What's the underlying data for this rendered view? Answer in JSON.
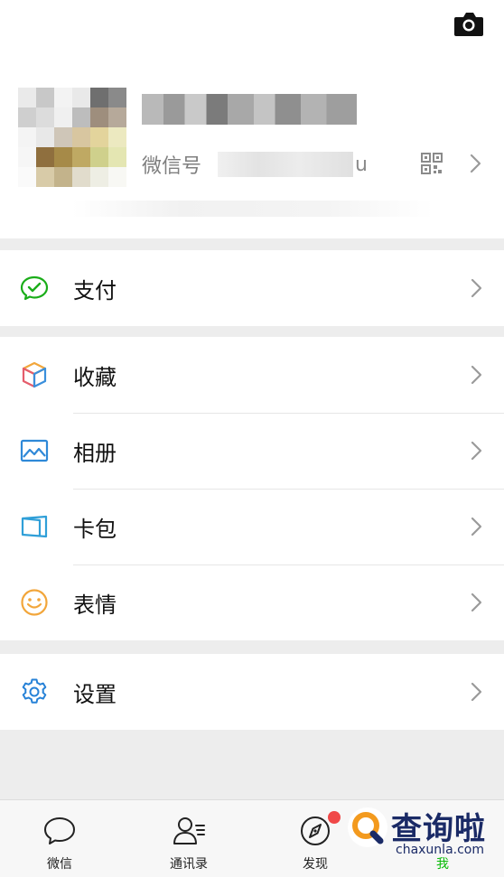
{
  "profile": {
    "wechat_id_label": "微信号",
    "wechat_id_tail": "u"
  },
  "menu": {
    "pay": "支付",
    "favorites": "收藏",
    "album": "相册",
    "cards": "卡包",
    "stickers": "表情",
    "settings": "设置"
  },
  "tabs": {
    "chats": "微信",
    "contacts": "通讯录",
    "discover": "发现",
    "me": "我"
  },
  "watermark": {
    "title": "查询啦",
    "domain": "chaxunla.com"
  },
  "colors": {
    "accent_green": "#09bb07",
    "pay_icon": "#1aad19",
    "badge_red": "#f04848",
    "settings_icon": "#2782d7"
  }
}
